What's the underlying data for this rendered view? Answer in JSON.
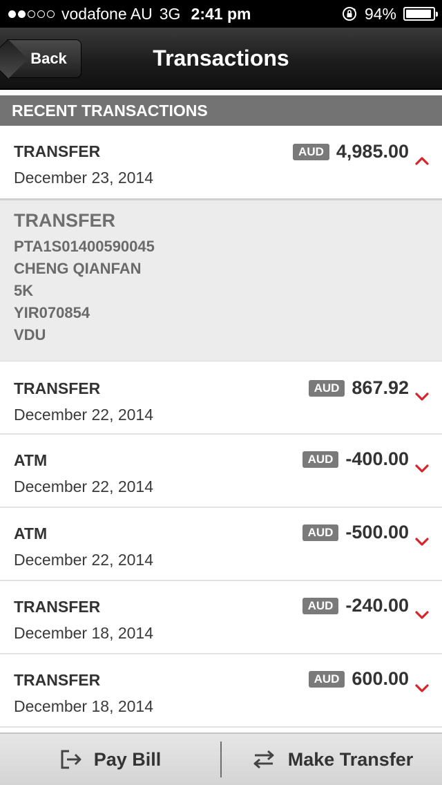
{
  "status_bar": {
    "carrier": "vodafone AU",
    "network": "3G",
    "time": "2:41 pm",
    "battery": "94%",
    "signal_dots_filled": 2,
    "signal_dots_total": 5
  },
  "nav": {
    "back_label": "Back",
    "title": "Transactions"
  },
  "section": {
    "header": "RECENT TRANSACTIONS"
  },
  "colors": {
    "chevron_red": "#d8232a",
    "badge_gray": "#7a7a7a",
    "header_gray": "#737373"
  },
  "transactions": [
    {
      "type": "TRANSFER",
      "date": "December 23, 2014",
      "currency": "AUD",
      "amount": "4,985.00",
      "expanded": true
    },
    {
      "type": "TRANSFER",
      "date": "December 22, 2014",
      "currency": "AUD",
      "amount": "867.92",
      "expanded": false
    },
    {
      "type": "ATM",
      "date": "December 22, 2014",
      "currency": "AUD",
      "amount": "-400.00",
      "expanded": false
    },
    {
      "type": "ATM",
      "date": "December 22, 2014",
      "currency": "AUD",
      "amount": "-500.00",
      "expanded": false
    },
    {
      "type": "TRANSFER",
      "date": "December 18, 2014",
      "currency": "AUD",
      "amount": "-240.00",
      "expanded": false
    },
    {
      "type": "TRANSFER",
      "date": "December 18, 2014",
      "currency": "AUD",
      "amount": "600.00",
      "expanded": false
    }
  ],
  "detail": {
    "title": "TRANSFER",
    "lines": [
      "PTA1S01400590045",
      "CHENG QIANFAN",
      "5K",
      "YIR070854",
      "VDU"
    ]
  },
  "toolbar": {
    "pay_bill_label": "Pay Bill",
    "pay_bill_icon": "exit-arrow-icon",
    "make_transfer_label": "Make Transfer",
    "make_transfer_icon": "swap-arrows-icon"
  }
}
